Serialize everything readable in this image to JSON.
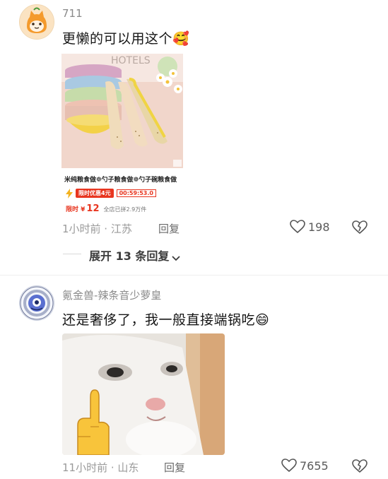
{
  "comments": [
    {
      "username": "711",
      "text": "更懒的可以用这个",
      "emoji": "🥰",
      "product": {
        "caption": "米纯粮食做❁勺子粮食做❁勺子碗粮食做",
        "promo_badge": "限时优惠4元",
        "timer": "00:59:53.0",
        "price_label": "限时 ¥",
        "price": "12",
        "sold": "全店已拼2.9万件"
      },
      "meta": "1小时前 · 江苏",
      "reply_label": "回复",
      "likes": "198"
    },
    {
      "username": "氪金兽-辣条音少萝皇",
      "text": "还是奢侈了，我一般直接端锅吃",
      "emoji": "😄",
      "meta": "11小时前 · 山东",
      "reply_label": "回复",
      "likes": "7655"
    }
  ],
  "expand_replies": "展开 13 条回复",
  "colors": {
    "accent_red": "#e8351f",
    "meta_gray": "#9a9a9a"
  },
  "icons": [
    "heart-icon",
    "dislike-icon",
    "chevron-down-icon"
  ]
}
